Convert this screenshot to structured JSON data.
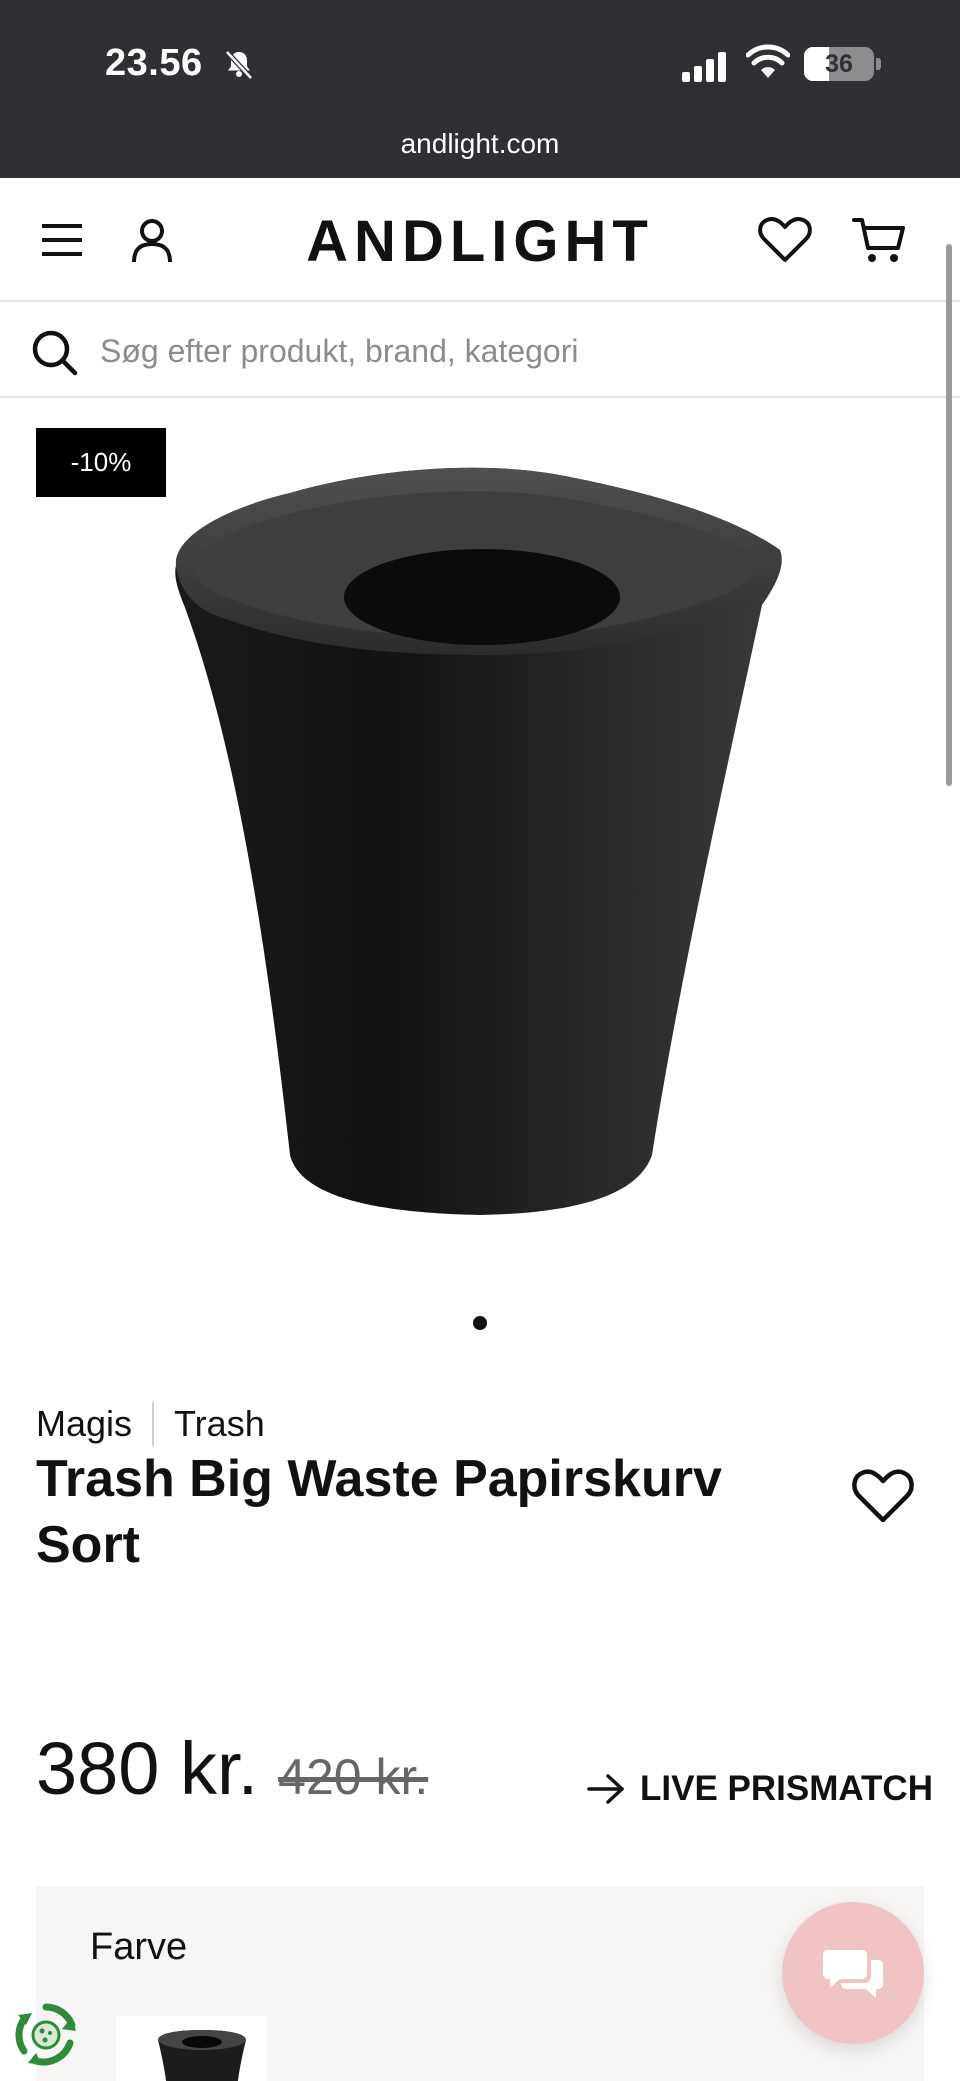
{
  "status_bar": {
    "time": "23.56",
    "battery_level": "36",
    "battery_fraction": 0.36,
    "url": "andlight.com"
  },
  "header": {
    "logo": "ANDLIGHT",
    "icons": [
      "menu-icon",
      "account-icon",
      "wishlist-icon",
      "cart-icon"
    ]
  },
  "search": {
    "placeholder": "Søg efter produkt, brand, kategori"
  },
  "product": {
    "discount_badge": "-10%",
    "gallery_slides": 1,
    "brand": "Magis",
    "collection": "Trash",
    "title": "Trash Big Waste Papirskurv Sort",
    "price_current": "380 kr.",
    "price_old": "420 kr.",
    "prismatch_label": "LIVE PRISMATCH"
  },
  "options": {
    "color_label": "Farve"
  },
  "widgets": {
    "chat_icon": "chat-bubbles-icon",
    "recycle_icon": "recycle-badge-icon"
  },
  "colors": {
    "status_bar_bg": "#2e3033",
    "badge_bg": "#000000",
    "chat_bg": "#f0c4c4",
    "panel_bg": "#f7f6f5",
    "recycle_green": "#2e8b3a"
  }
}
